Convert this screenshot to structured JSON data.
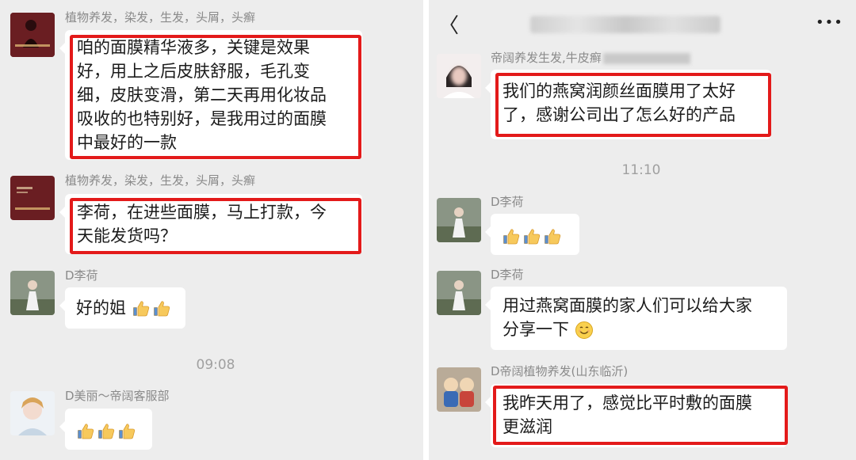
{
  "left": {
    "group_name": "植物养发，染发，生发，头屑，头癣",
    "msg1_lines": [
      "咱的面膜精华液多，关键是效果",
      "好，用上之后皮肤舒服，毛孔变",
      "细，皮肤变滑，第二天再用化妆品",
      "吸收的也特别好，是我用过的面膜",
      "中最好的一款"
    ],
    "msg2_lines": [
      "李荷，在进些面膜，马上打款，今",
      "天能发货吗？"
    ],
    "sender_d_lihe": "D李荷",
    "msg3_text": "好的姐",
    "time_0908": "09:08",
    "sender_d_meili": "D美丽～帝阔客服部"
  },
  "right": {
    "header_back": "〈",
    "header_more": "•••",
    "sender_top": "帝阔养发生发,牛皮癣",
    "msg1_lines": [
      "我们的燕窝润颜丝面膜用了太好",
      "了，感谢公司出了怎么好的产品"
    ],
    "time_1110": "11:10",
    "sender_d_lihe_1": "D李荷",
    "sender_d_lihe_2": "D李荷",
    "msg3_lines": [
      "用过燕窝面膜的家人们可以给大家",
      "分享一下"
    ],
    "sender_dikuo": "D帝阔植物养发(山东临沂)",
    "msg4_lines": [
      "我昨天用了，感觉比平时敷的面膜",
      "更滋润"
    ]
  },
  "icons": {
    "thumbs_up": "thumbs-up-emoji",
    "smile": "smile-emoji"
  },
  "colors": {
    "chat_bg": "#ededed",
    "highlight": "#e31a1a"
  }
}
